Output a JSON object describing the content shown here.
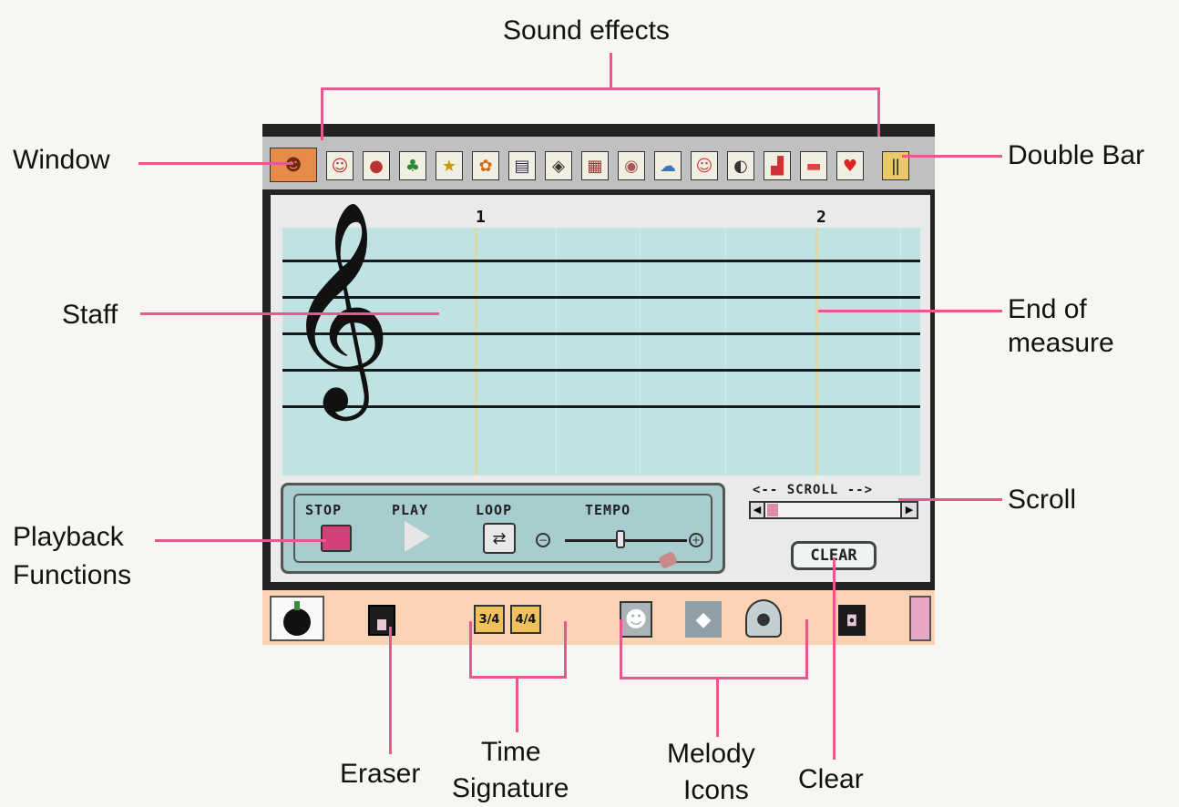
{
  "callouts": {
    "sound_effects": "Sound effects",
    "window": "Window",
    "double_bar": "Double Bar",
    "staff": "Staff",
    "end_of_measure_line1": "End of",
    "end_of_measure_line2": "measure",
    "scroll": "Scroll",
    "playback_line1": "Playback",
    "playback_line2": "Functions",
    "eraser": "Eraser",
    "time_sig_line1": "Time",
    "time_sig_line2": "Signature",
    "melody_line1": "Melody",
    "melody_line2": "Icons",
    "clear": "Clear"
  },
  "ui": {
    "measure_numbers": [
      "1",
      "2"
    ],
    "playback": {
      "stop": "STOP",
      "play": "PLAY",
      "loop": "LOOP",
      "tempo": "TEMPO"
    },
    "scroll_label": "<-- SCROLL -->",
    "clear_button": "CLEAR",
    "time_signatures": [
      "3/4",
      "4/4"
    ]
  },
  "icons": {
    "window": "mario-face-icon",
    "sound_effects": [
      "mario-icon",
      "mushroom-icon",
      "yoshi-icon",
      "star-icon",
      "flower-icon",
      "ship-icon",
      "cat-icon",
      "car-icon",
      "pig-icon",
      "baby-icon",
      "face-icon",
      "dog-icon",
      "boat-icon",
      "car2-icon",
      "heart-icon"
    ],
    "double_bar": "double-bar-icon"
  },
  "colors": {
    "accent_pink": "#e8588f",
    "staff_bg": "#bfe2e3",
    "bottom_bar": "#fbd2b4"
  }
}
